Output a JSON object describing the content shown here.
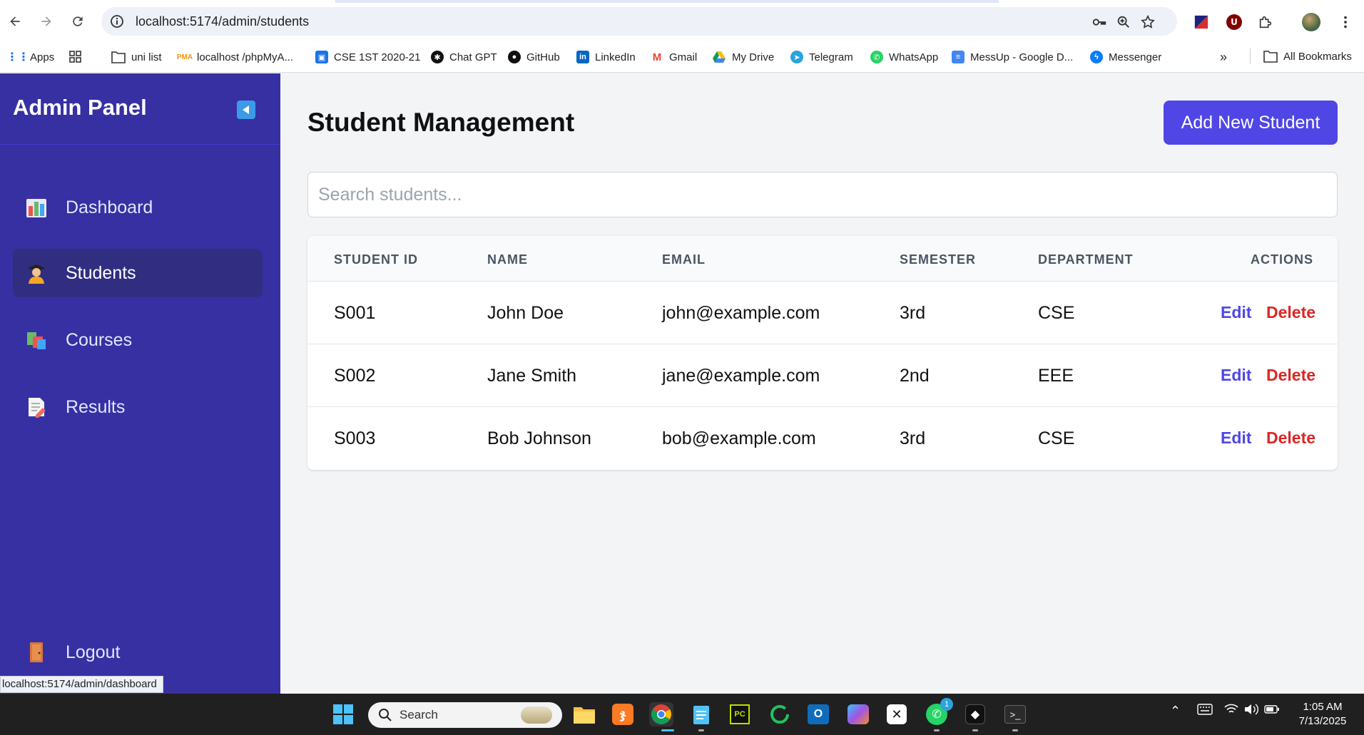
{
  "browser": {
    "url": "localhost:5174/admin/students",
    "bookmarks": [
      {
        "label": "Apps",
        "icon": "apps-grid-icon"
      },
      {
        "label": "",
        "icon": "tab-groups-icon"
      },
      {
        "label": "uni list",
        "icon": "folder-icon"
      },
      {
        "label": "localhost /phpMyA...",
        "icon": "phpmyadmin-icon"
      },
      {
        "label": "CSE 1ST 2020-21",
        "icon": "contacts-icon"
      },
      {
        "label": "Chat GPT",
        "icon": "chatgpt-icon"
      },
      {
        "label": "GitHub",
        "icon": "github-icon"
      },
      {
        "label": "LinkedIn",
        "icon": "linkedin-icon"
      },
      {
        "label": "Gmail",
        "icon": "gmail-icon"
      },
      {
        "label": "My Drive",
        "icon": "drive-icon"
      },
      {
        "label": "Telegram",
        "icon": "telegram-icon"
      },
      {
        "label": "WhatsApp",
        "icon": "whatsapp-icon"
      },
      {
        "label": "MessUp - Google D...",
        "icon": "google-docs-icon"
      },
      {
        "label": "Messenger",
        "icon": "messenger-icon"
      }
    ],
    "all_bookmarks": "All Bookmarks",
    "status_url": "localhost:5174/admin/dashboard"
  },
  "sidebar": {
    "title": "Admin Panel",
    "items": [
      {
        "label": "Dashboard",
        "icon": "bar-chart-icon"
      },
      {
        "label": "Students",
        "icon": "student-icon"
      },
      {
        "label": "Courses",
        "icon": "books-icon"
      },
      {
        "label": "Results",
        "icon": "document-pencil-icon"
      }
    ],
    "logout": {
      "label": "Logout",
      "icon": "door-icon"
    }
  },
  "main": {
    "title": "Student Management",
    "add_button": "Add New Student",
    "search_placeholder": "Search students...",
    "table": {
      "headers": [
        "STUDENT ID",
        "NAME",
        "EMAIL",
        "SEMESTER",
        "DEPARTMENT",
        "ACTIONS"
      ],
      "rows": [
        {
          "id": "S001",
          "name": "John Doe",
          "email": "john@example.com",
          "semester": "3rd",
          "department": "CSE",
          "edit": "Edit",
          "delete": "Delete"
        },
        {
          "id": "S002",
          "name": "Jane Smith",
          "email": "jane@example.com",
          "semester": "2nd",
          "department": "EEE",
          "edit": "Edit",
          "delete": "Delete"
        },
        {
          "id": "S003",
          "name": "Bob Johnson",
          "email": "bob@example.com",
          "semester": "3rd",
          "department": "CSE",
          "edit": "Edit",
          "delete": "Delete"
        }
      ]
    }
  },
  "taskbar": {
    "search_label": "Search",
    "whatsapp_badge": "1",
    "time": "1:05 AM",
    "date": "7/13/2025"
  },
  "colors": {
    "sidebar_bg": "#3730a3",
    "sidebar_active": "#312e81",
    "primary": "#4f46e5",
    "danger": "#dc2626"
  }
}
